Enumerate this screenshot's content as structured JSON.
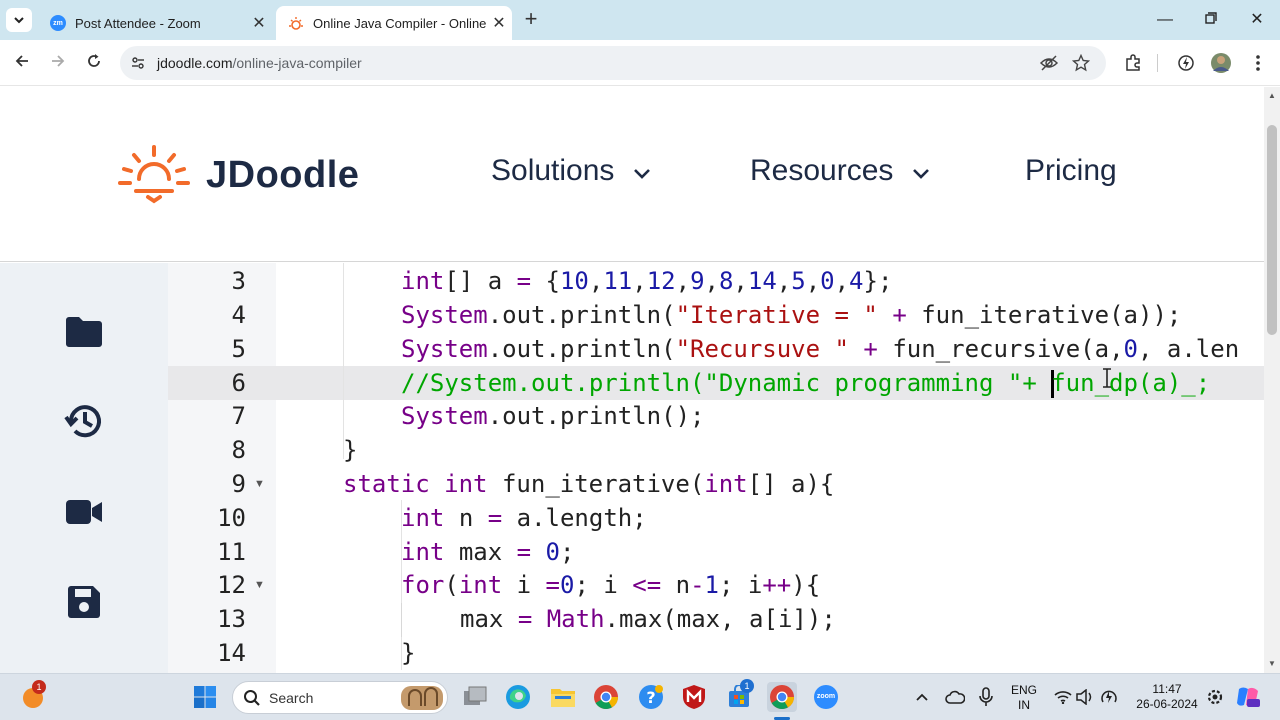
{
  "browser": {
    "tabs": [
      {
        "title": "Post Attendee - Zoom",
        "favicon": "zoom-icon"
      },
      {
        "title": "Online Java Compiler - Online I",
        "favicon": "jdoodle-icon"
      }
    ],
    "url_domain": "jdoodle.com",
    "url_path": "/online-java-compiler"
  },
  "site": {
    "logo_text": "JDoodle",
    "nav": [
      "Solutions",
      "Resources",
      "Pricing"
    ],
    "brand_color": "#f26b2a",
    "text_color": "#1d2a44"
  },
  "editor": {
    "sidebar_icons": [
      "folder-icon",
      "history-icon",
      "video-icon",
      "save-icon"
    ],
    "line_numbers": [
      "3",
      "4",
      "5",
      "6",
      "7",
      "8",
      "9",
      "10",
      "11",
      "12",
      "13",
      "14"
    ],
    "highlighted_line": "6",
    "lines": [
      [
        "int[] a = {10,11,12,9,8,14,5,0,4};"
      ],
      [
        "System.out.println(\"Iterative = \" + fun_iterative(a));"
      ],
      [
        "System.out.println(\"Recursuve \" + fun_recursive(a,0, a.len"
      ],
      [
        "//System.out.println(\"Dynamic programming \"+ ",
        "fun_dp(a)_;"
      ],
      [
        "System.out.println();"
      ],
      [
        "}"
      ],
      [
        "static int fun_iterative(int[] a){"
      ],
      [
        "int n = a.length;"
      ],
      [
        "int max = 0;"
      ],
      [
        "for(int i =0; i <= n-1; i++){"
      ],
      [
        "max = Math.max(max, a[i]);"
      ],
      [
        "}"
      ]
    ]
  },
  "taskbar": {
    "search_label": "Search",
    "notification_count": "1",
    "store_badge": "1",
    "language_line1": "ENG",
    "language_line2": "IN",
    "time": "11:47",
    "date": "26-06-2024",
    "zoom_label": "zoom"
  }
}
